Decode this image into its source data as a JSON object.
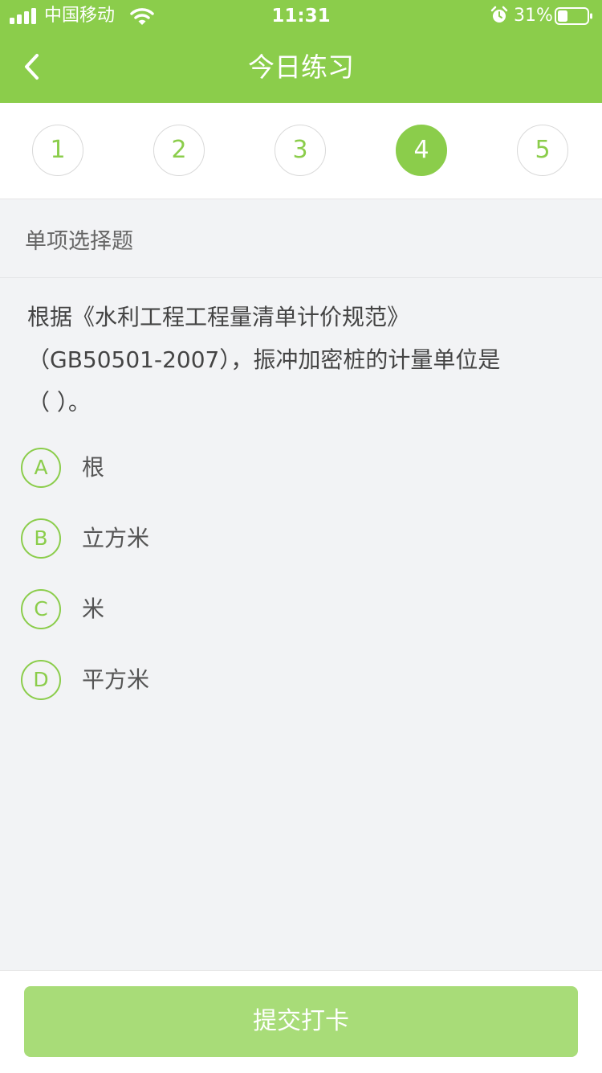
{
  "status_bar": {
    "carrier": "中国移动",
    "time": "11:31",
    "battery": "31%",
    "icons": [
      "signal-icon",
      "wifi-icon",
      "alarm-icon",
      "battery-icon"
    ]
  },
  "header": {
    "title": "今日练习",
    "back_icon": "chevron-left-icon",
    "background_color": "#8bcd4b"
  },
  "question_nav": {
    "items": [
      "1",
      "2",
      "3",
      "4",
      "5"
    ],
    "active": "4"
  },
  "question": {
    "type": "单项选择题",
    "text": "根据《水利工程工程量清单计价规范》\n（GB50501-2007），振冲加密桩的计量单位是\n（    ）。",
    "options": [
      {
        "letter": "A",
        "text": "根"
      },
      {
        "letter": "B",
        "text": "立方米"
      },
      {
        "letter": "C",
        "text": "米"
      },
      {
        "letter": "D",
        "text": "平方米"
      }
    ]
  },
  "footer": {
    "submit_label": "提交打卡",
    "button_color": "#a8dc78"
  }
}
